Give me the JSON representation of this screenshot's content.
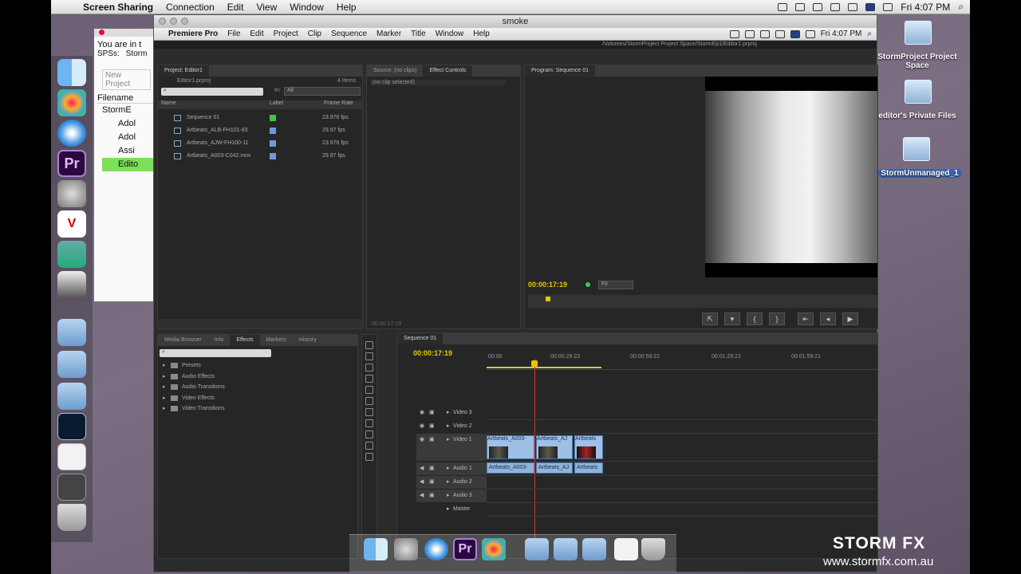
{
  "menubar": {
    "apple": "",
    "items": [
      "Screen Sharing",
      "Connection",
      "Edit",
      "View",
      "Window",
      "Help"
    ],
    "clock": "Fri 4:07 PM"
  },
  "window": {
    "title": "smoke"
  },
  "inner_menubar": {
    "app": "Premiere Pro",
    "items": [
      "File",
      "Edit",
      "Project",
      "Clip",
      "Sequence",
      "Marker",
      "Title",
      "Window",
      "Help"
    ],
    "clock": "Fri 4:07 PM"
  },
  "path": "/Volumes/StormProject Project Space/StormEp1/Editor1.prproj",
  "bg_window": {
    "text1": "You are in t",
    "spss": "SPSs:",
    "storm": "Storm",
    "new_project": "New Project",
    "filename": "Filename",
    "rows": [
      "StormE",
      "Adol",
      "Adol",
      "Assi",
      "Edito"
    ]
  },
  "project": {
    "tab": "Project: Editor1",
    "file": "Editor1.prproj",
    "count": "4 Items",
    "in_label": "In:",
    "in_value": "All",
    "headers": {
      "name": "Name",
      "label": "Label",
      "frame_rate": "Frame Rate"
    },
    "items": [
      {
        "name": "Sequence 01",
        "rate": "23.976 fps",
        "color": "#44c244"
      },
      {
        "name": "Artbeats_ALB-FH101-83",
        "rate": "29.97 fps",
        "color": "#6f9ad8"
      },
      {
        "name": "Artbeats_AJW-FH100-11",
        "rate": "23.976 fps",
        "color": "#6f9ad8"
      },
      {
        "name": "Artbeats_A003-C042.mov",
        "rate": "29.97 fps",
        "color": "#6f9ad8"
      }
    ]
  },
  "source": {
    "tab1": "Source: (no clips)",
    "tab2": "Effect Controls",
    "no_clip": "(no clip selected)",
    "timecode": "00:00:17:19"
  },
  "program": {
    "tab": "Program: Sequence 01",
    "timecode": "00:00:17:19",
    "fit": "Fit"
  },
  "effects": {
    "tabs": [
      "Media Browser",
      "Info",
      "Effects",
      "Markers",
      "History"
    ],
    "items": [
      "Presets",
      "Audio Effects",
      "Audio Transitions",
      "Video Effects",
      "Video Transitions"
    ]
  },
  "timeline": {
    "tab": "Sequence 01",
    "timecode": "00:00:17:19",
    "ruler": [
      "00:00",
      "00:00:29:23",
      "00:00:59:22",
      "00:01:29:21",
      "00:01:59:21"
    ],
    "tracks": [
      "Video 3",
      "Video 2",
      "Video 1",
      "Audio 1",
      "Audio 2",
      "Audio 3",
      "Master"
    ],
    "video_clips": [
      "Artbeats_A003-",
      "Artbeats_AJ",
      "Artbeats"
    ],
    "audio_clips": [
      "Artbeats_A003-",
      "Artbeats_AJ",
      "Artbeats"
    ]
  },
  "desktop": {
    "icons": [
      "StormProject Project Space",
      "editor's Private Files",
      "StormUnmanaged_1"
    ]
  },
  "watermark": {
    "brand": "STORM FX",
    "url": "www.stormfx.com.au"
  }
}
